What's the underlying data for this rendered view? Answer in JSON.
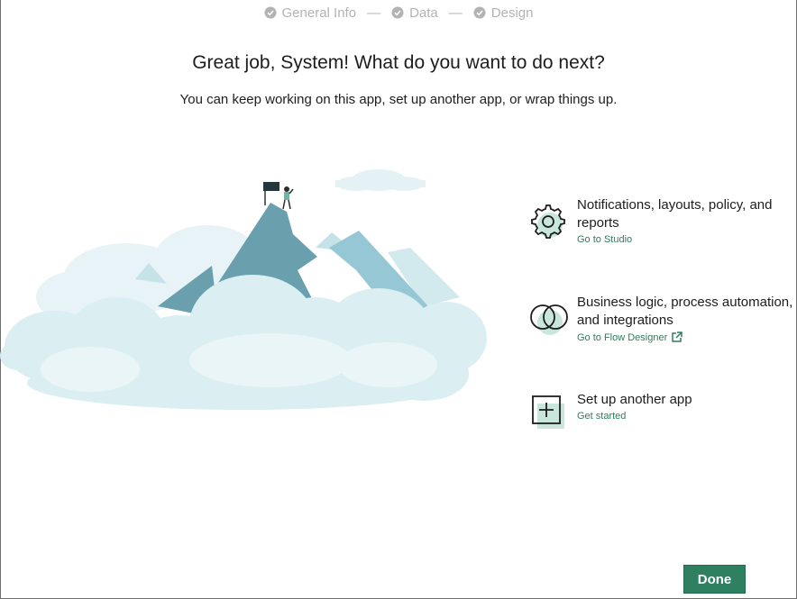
{
  "stepper": {
    "steps": [
      {
        "label": "General Info"
      },
      {
        "label": "Data"
      },
      {
        "label": "Design"
      }
    ],
    "separator": "—"
  },
  "heading": {
    "title": "Great job, System! What do you want to do next?",
    "subtitle": "You can keep working on this app, set up another app, or wrap things up."
  },
  "options": [
    {
      "title": "Notifications, layouts, policy, and reports",
      "link": "Go to Studio",
      "icon": "gear-icon"
    },
    {
      "title": "Business logic, process automation, and integrations",
      "link": "Go to Flow Designer",
      "icon": "overlapping-circles-icon"
    },
    {
      "title": "Set up another app",
      "link": "Get started",
      "icon": "plus-box-icon"
    }
  ],
  "footer": {
    "done_label": "Done"
  },
  "colors": {
    "accent": "#2e8060",
    "link": "#2e7d5b",
    "stepper": "#b3b3b3",
    "mountain": "#6a9fae",
    "cloud": "#dbeef2"
  }
}
